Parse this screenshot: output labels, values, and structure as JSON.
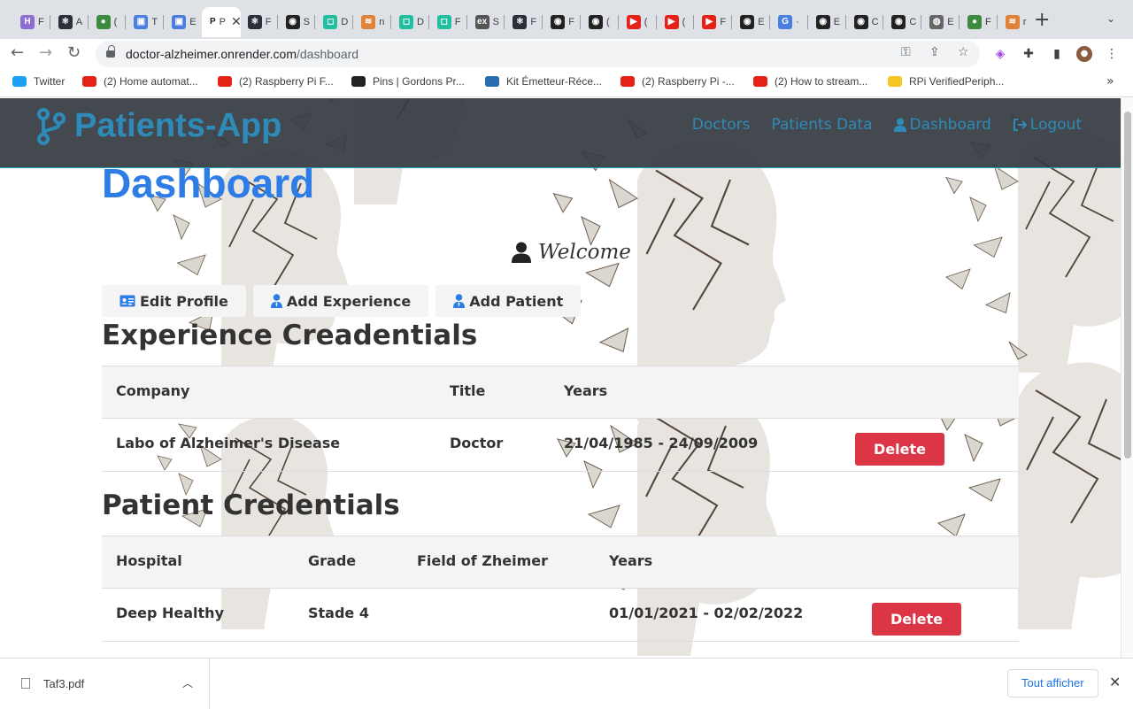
{
  "browser": {
    "tabs": [
      {
        "letter": "H",
        "title": "F",
        "color": "#8e6fd1"
      },
      {
        "letter": "⚛",
        "title": "A",
        "color": "#2a2f3a"
      },
      {
        "letter": "●",
        "title": "(",
        "color": "#3c8b3f"
      },
      {
        "letter": "▣",
        "title": "T",
        "color": "#4a7ee0"
      },
      {
        "letter": "▣",
        "title": "E",
        "color": "#4a7ee0"
      },
      {
        "letter": "P",
        "title": "P",
        "color": "#ffffff"
      },
      {
        "letter": "⚛",
        "title": "F",
        "color": "#2a2f3a"
      },
      {
        "letter": "◉",
        "title": "S",
        "color": "#222"
      },
      {
        "letter": "◻",
        "title": "D",
        "color": "#1fbf9f"
      },
      {
        "letter": "≋",
        "title": "n",
        "color": "#e0823a"
      },
      {
        "letter": "◻",
        "title": "D",
        "color": "#1fbf9f"
      },
      {
        "letter": "◻",
        "title": "F",
        "color": "#1fbf9f"
      },
      {
        "letter": "ex",
        "title": "S",
        "color": "#555"
      },
      {
        "letter": "⚛",
        "title": "F",
        "color": "#2a2f3a"
      },
      {
        "letter": "◉",
        "title": "F",
        "color": "#222"
      },
      {
        "letter": "◉",
        "title": "(",
        "color": "#222"
      },
      {
        "letter": "▶",
        "title": "(",
        "color": "#e62117"
      },
      {
        "letter": "▶",
        "title": "(",
        "color": "#e62117"
      },
      {
        "letter": "▶",
        "title": "F",
        "color": "#e62117"
      },
      {
        "letter": "◉",
        "title": "E",
        "color": "#222"
      },
      {
        "letter": "G",
        "title": "·",
        "color": "#4a7ee0"
      },
      {
        "letter": "◉",
        "title": "E",
        "color": "#222"
      },
      {
        "letter": "◉",
        "title": "C",
        "color": "#222"
      },
      {
        "letter": "◉",
        "title": "C",
        "color": "#222"
      },
      {
        "letter": "◍",
        "title": "E",
        "color": "#666"
      },
      {
        "letter": "●",
        "title": "F",
        "color": "#3c8b3f"
      },
      {
        "letter": "≋",
        "title": "r",
        "color": "#e0823a"
      }
    ],
    "active_tab_index": 5,
    "new_tab_label": "+",
    "url_host": "doctor-alzheimer.onrender.com",
    "url_path": "/dashboard",
    "bookmarks": [
      {
        "label": "Twitter",
        "color": "#1da1f2"
      },
      {
        "label": "(2) Home automat...",
        "color": "#e62117"
      },
      {
        "label": "(2) Raspberry Pi F...",
        "color": "#e62117"
      },
      {
        "label": "Pins | Gordons Pr...",
        "color": "#222222"
      },
      {
        "label": "Kit Émetteur-Réce...",
        "color": "#2b6cb0"
      },
      {
        "label": "(2) Raspberry Pi -...",
        "color": "#e62117"
      },
      {
        "label": "(2) How to stream...",
        "color": "#e62117"
      },
      {
        "label": "RPi VerifiedPeriph...",
        "color": "#f3c623"
      }
    ],
    "bookmarks_more": "»"
  },
  "page": {
    "brand": "Patients-App",
    "nav": {
      "doctors": "Doctors",
      "patients_data": "Patients Data",
      "dashboard": "Dashboard",
      "logout": "Logout"
    },
    "title": "Dashboard",
    "welcome": "Welcome",
    "actions": {
      "edit_profile": "Edit Profile",
      "add_experience": "Add Experience",
      "add_patient": "Add Patient"
    },
    "experience": {
      "heading": "Experience Creadentials",
      "columns": [
        "Company",
        "Title",
        "Years"
      ],
      "rows": [
        {
          "company": "Labo of Alzheimer's Disease",
          "title": "Doctor",
          "years": "21/04/1985 - 24/09/2009",
          "action": "Delete"
        }
      ]
    },
    "patients": {
      "heading": "Patient Credentials",
      "columns": [
        "Hospital",
        "Grade",
        "Field of Zheimer",
        "Years"
      ],
      "rows": [
        {
          "hospital": "Deep Healthy",
          "grade": "Stade 4",
          "field": "",
          "years": "01/01/2021 - 02/02/2022",
          "action": "Delete"
        }
      ]
    },
    "colors": {
      "brand": "#2e8bb8",
      "title": "#2e7de6",
      "danger": "#dc3545",
      "navbar": "#343a40"
    }
  },
  "downloads": {
    "file_name": "Taf3.pdf",
    "show_all": "Tout afficher",
    "close": "✕"
  }
}
